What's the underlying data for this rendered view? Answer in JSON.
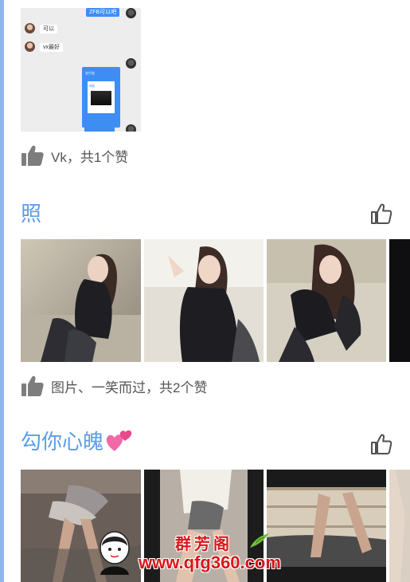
{
  "colors": {
    "accent": "#5d9ce6",
    "left_stripe": "#8fb7ea",
    "like_text": "#555555",
    "watermark_red": "#d8161b",
    "chat_blue": "#3d8ef3"
  },
  "post1": {
    "chat_screenshot": {
      "bubble_top": "ZFB可以吧",
      "msg1": "可以",
      "msg2": "vx最好",
      "card_app": "支付宝",
      "card_title": "转账",
      "bubble_bottom": ""
    },
    "likes_text": "Vk，共1个赞",
    "like_icon": "thumbs-up-filled-icon"
  },
  "post2": {
    "title": "照",
    "like_button_icon": "thumbs-up-outline-icon",
    "photos": [
      {
        "name": "photo-1",
        "desc_icon": "photo"
      },
      {
        "name": "photo-2",
        "desc_icon": "photo"
      },
      {
        "name": "photo-3",
        "desc_icon": "photo"
      },
      {
        "name": "photo-4",
        "desc_icon": "photo"
      }
    ],
    "likes_text": "图片、一笑而过，共2个赞",
    "like_icon": "thumbs-up-filled-icon"
  },
  "post3": {
    "title": "勾你心魄",
    "title_emoji": "two-hearts-emoji",
    "like_button_icon": "thumbs-up-outline-icon",
    "photos": [
      {
        "name": "photo-1"
      },
      {
        "name": "photo-2"
      },
      {
        "name": "photo-3"
      },
      {
        "name": "photo-4"
      }
    ]
  },
  "watermark": {
    "site_name": "群芳阁",
    "url": "www.qfg360.com"
  }
}
